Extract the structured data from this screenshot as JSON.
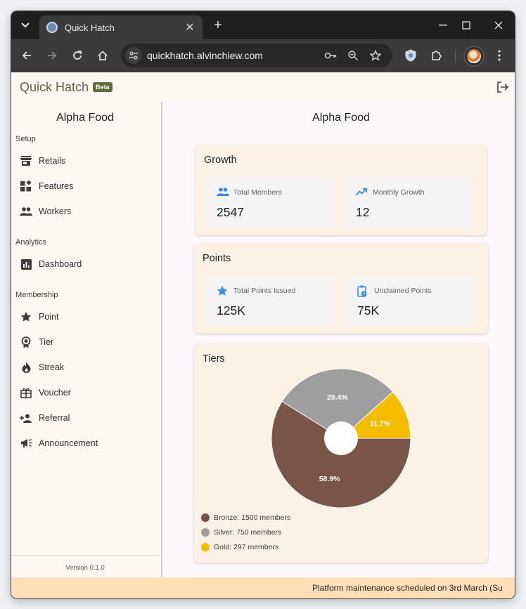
{
  "browser": {
    "tab_title": "Quick Hatch",
    "url": "quickhatch.alvinchiew.com"
  },
  "app": {
    "brand": "Quick Hatch",
    "badge": "Beta"
  },
  "sidebar": {
    "title": "Alpha Food",
    "sections": [
      {
        "label": "Setup",
        "items": [
          {
            "label": "Retails",
            "icon": "store-icon"
          },
          {
            "label": "Features",
            "icon": "widgets-icon"
          },
          {
            "label": "Workers",
            "icon": "people-icon"
          }
        ]
      },
      {
        "label": "Analytics",
        "items": [
          {
            "label": "Dashboard",
            "icon": "analytics-icon"
          }
        ]
      },
      {
        "label": "Membership",
        "items": [
          {
            "label": "Point",
            "icon": "star-icon"
          },
          {
            "label": "Tier",
            "icon": "badge-icon"
          },
          {
            "label": "Streak",
            "icon": "fire-icon"
          },
          {
            "label": "Voucher",
            "icon": "gift-icon"
          },
          {
            "label": "Referral",
            "icon": "person-add-icon"
          },
          {
            "label": "Announcement",
            "icon": "campaign-icon"
          }
        ]
      }
    ],
    "version": "Version 0.1.0"
  },
  "main": {
    "title": "Alpha Food",
    "growth": {
      "title": "Growth",
      "stats": [
        {
          "label": "Total Members",
          "value": "2547",
          "icon": "group-icon"
        },
        {
          "label": "Monthly Growth",
          "value": "12",
          "icon": "trending-up-icon"
        }
      ]
    },
    "points": {
      "title": "Points",
      "stats": [
        {
          "label": "Total Points Issued",
          "value": "125K",
          "icon": "star-icon"
        },
        {
          "label": "Unclaimed Points",
          "value": "75K",
          "icon": "clipboard-clock-icon"
        }
      ]
    },
    "tiers": {
      "title": "Tiers"
    }
  },
  "chart_data": {
    "type": "pie",
    "donut": true,
    "title": "Tiers",
    "series": [
      {
        "name": "Bronze",
        "value": 1500,
        "percent_label": "58.9%",
        "color": "#795548"
      },
      {
        "name": "Silver",
        "value": 750,
        "percent_label": "29.4%",
        "color": "#9e9e9e"
      },
      {
        "name": "Gold",
        "value": 297,
        "percent_label": "11.7%",
        "color": "#f5bc00"
      }
    ],
    "legend": [
      "Bronze: 1500 members",
      "Silver: 750 members",
      "Gold: 297 members"
    ],
    "legend_position": "bottom-left"
  },
  "banner": {
    "text": "Platform maintenance scheduled on 3rd March (Su"
  },
  "colors": {
    "accent_icon": "#3b8ee0",
    "banner_bg": "#fde0b8",
    "card_bg": "#fdf0e4",
    "badge_bg": "#5e6b3d"
  }
}
